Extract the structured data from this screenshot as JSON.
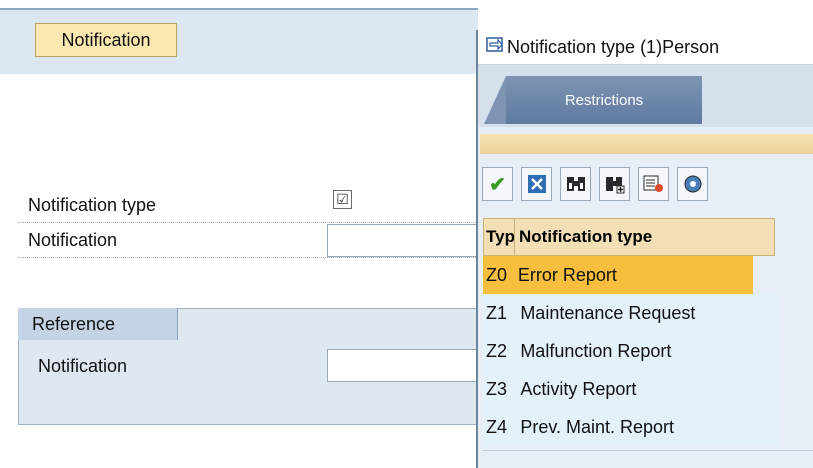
{
  "left": {
    "notification_button": "Notification",
    "fields": [
      {
        "label": "Notification type"
      },
      {
        "label": "Notification"
      }
    ],
    "reference": {
      "tab_label": "Reference",
      "field_label": "Notification"
    }
  },
  "popup": {
    "title": "Notification type (1)Person",
    "tab_label": "Restrictions",
    "toolbar_icons": [
      "check-icon",
      "cancel-icon",
      "find-icon",
      "find-next-icon",
      "select-icon",
      "settings-icon"
    ],
    "table": {
      "columns": [
        "Typ",
        "Notification type"
      ],
      "rows": [
        {
          "code": "Z0",
          "name": "Error Report",
          "selected": true
        },
        {
          "code": "Z1",
          "name": "Maintenance Request",
          "selected": false
        },
        {
          "code": "Z2",
          "name": "Malfunction Report",
          "selected": false
        },
        {
          "code": "Z3",
          "name": "Activity Report",
          "selected": false
        },
        {
          "code": "Z4",
          "name": "Prev. Maint. Report",
          "selected": false
        }
      ]
    }
  },
  "colors": {
    "selected_row": "#f8be3e",
    "row_bg": "#e3f1fb",
    "header_bg": "#f2dfb5",
    "tab_bg": "#6f88aa"
  }
}
